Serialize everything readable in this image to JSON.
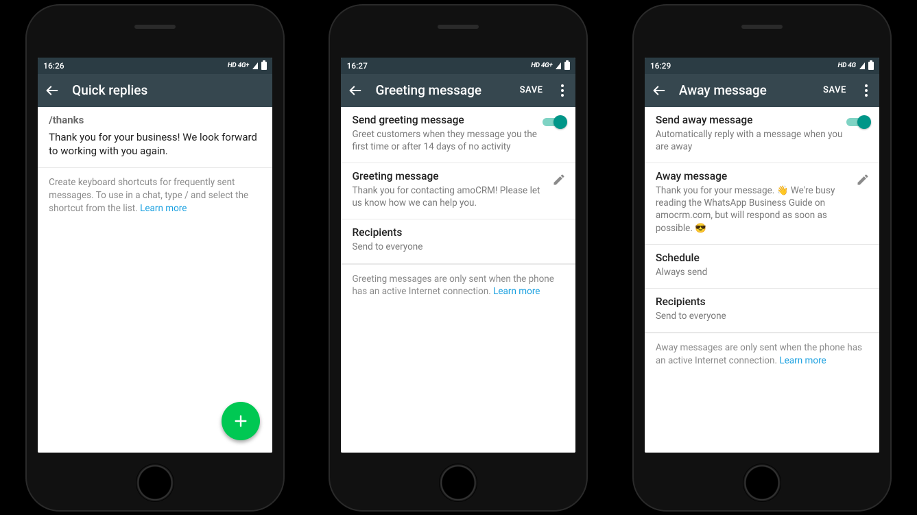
{
  "phones": [
    {
      "status": {
        "time": "16:26",
        "network": "HD 4G+"
      },
      "appbar": {
        "title": "Quick replies",
        "save": null
      },
      "quickReply": {
        "shortcut": "/thanks",
        "message": "Thank you for your business! We look forward to working with you again."
      },
      "hint": "Create keyboard shortcuts for frequently sent messages. To use in a chat, type / and select the shortcut from the list. ",
      "learnMore": "Learn more"
    },
    {
      "status": {
        "time": "16:27",
        "network": "HD 4G+"
      },
      "appbar": {
        "title": "Greeting message",
        "save": "SAVE"
      },
      "sections": {
        "toggle": {
          "title": "Send greeting message",
          "sub": "Greet customers when they message you the first time or after 14 days of no activity"
        },
        "message": {
          "title": "Greeting message",
          "sub": "Thank you for contacting amoCRM! Please let us know how we can help you."
        },
        "recipients": {
          "title": "Recipients",
          "sub": "Send to everyone"
        }
      },
      "hint": "Greeting messages are only sent when the phone has an active Internet connection. ",
      "learnMore": "Learn more"
    },
    {
      "status": {
        "time": "16:29",
        "network": "HD 4G"
      },
      "appbar": {
        "title": "Away message",
        "save": "SAVE"
      },
      "sections": {
        "toggle": {
          "title": "Send away message",
          "sub": "Automatically reply with a message when you are away"
        },
        "message": {
          "title": "Away message",
          "sub": "Thank you for your message. 👋 We're busy reading the WhatsApp Business Guide on amocrm.com, but will respond as soon as possible. 😎"
        },
        "schedule": {
          "title": "Schedule",
          "sub": "Always send"
        },
        "recipients": {
          "title": "Recipients",
          "sub": "Send to everyone"
        }
      },
      "hint": "Away messages are only sent when the phone has an active Internet connection. ",
      "learnMore": "Learn more"
    }
  ]
}
